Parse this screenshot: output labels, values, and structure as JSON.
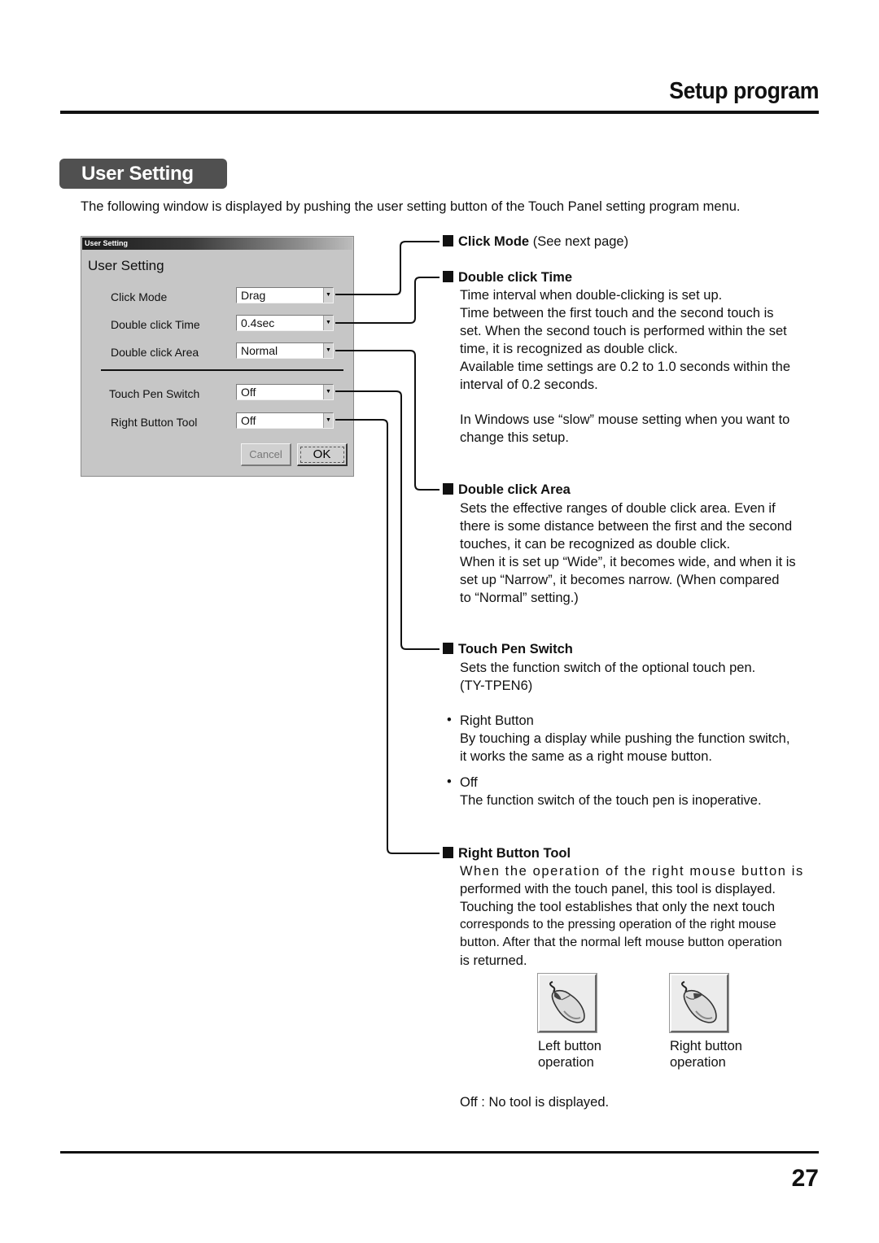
{
  "header": {
    "title": "Setup program"
  },
  "section": {
    "title": "User Setting"
  },
  "intro": "The following window is displayed by pushing the user setting button of the Touch Panel setting program menu.",
  "dialog": {
    "window_title": "User Setting",
    "heading": "User Setting",
    "fields": [
      {
        "label": "Click Mode",
        "value": "Drag"
      },
      {
        "label": "Double click Time",
        "value": "0.4sec"
      },
      {
        "label": "Double click Area",
        "value": "Normal"
      },
      {
        "label": "Touch Pen Switch",
        "value": "Off"
      },
      {
        "label": "Right Button Tool",
        "value": "Off"
      }
    ],
    "dropdown_arrow": "▼",
    "cancel_label": "Cancel",
    "ok_label": "OK"
  },
  "descriptions": {
    "click_mode": {
      "title": "Click Mode",
      "note": " (See next page)"
    },
    "double_click_time": {
      "title": "Double click Time",
      "lines": [
        "Time interval when double-clicking is set up.",
        "Time between the first touch and the second touch is",
        "set. When the second touch is performed within the set",
        "time, it is recognized as double click.",
        "Available time settings are 0.2 to 1.0 seconds within the",
        "interval of 0.2 seconds."
      ],
      "windows_note": [
        "In Windows use “slow” mouse setting when you want to",
        "change this setup."
      ]
    },
    "double_click_area": {
      "title": "Double click Area",
      "lines": [
        "Sets the effective ranges of double click area. Even if",
        "there is some distance between the first and the second",
        "touches, it can be recognized as double click.",
        "When it is set up “Wide”, it becomes wide, and when it is",
        "set up “Narrow”, it becomes narrow. (When compared",
        "to “Normal” setting.)"
      ]
    },
    "touch_pen_switch": {
      "title": "Touch Pen Switch",
      "lines": [
        "Sets the function switch of the optional touch pen.",
        "(TY-TPEN6)"
      ],
      "options": [
        {
          "name": "Right Button",
          "lines": [
            "By touching a display while pushing the function switch,",
            "it works the same as a right mouse button."
          ]
        },
        {
          "name": "Off",
          "lines": [
            "The function switch of the touch pen is inoperative."
          ]
        }
      ]
    },
    "right_button_tool": {
      "title": "Right Button Tool",
      "lines": [
        "When the operation of the right mouse button is",
        "performed with the touch panel, this tool is displayed.",
        "Touching the tool establishes that only the next touch",
        "corresponds to the pressing operation of the right mouse",
        "button. After that the normal left mouse button operation",
        "is returned."
      ],
      "tools": [
        {
          "icon": "mouse-left-button-icon",
          "caption": [
            "Left button",
            "operation"
          ]
        },
        {
          "icon": "mouse-right-button-icon",
          "caption": [
            "Right button",
            "operation"
          ]
        }
      ],
      "off_note": "Off : No tool is displayed."
    }
  },
  "page_number": "27"
}
